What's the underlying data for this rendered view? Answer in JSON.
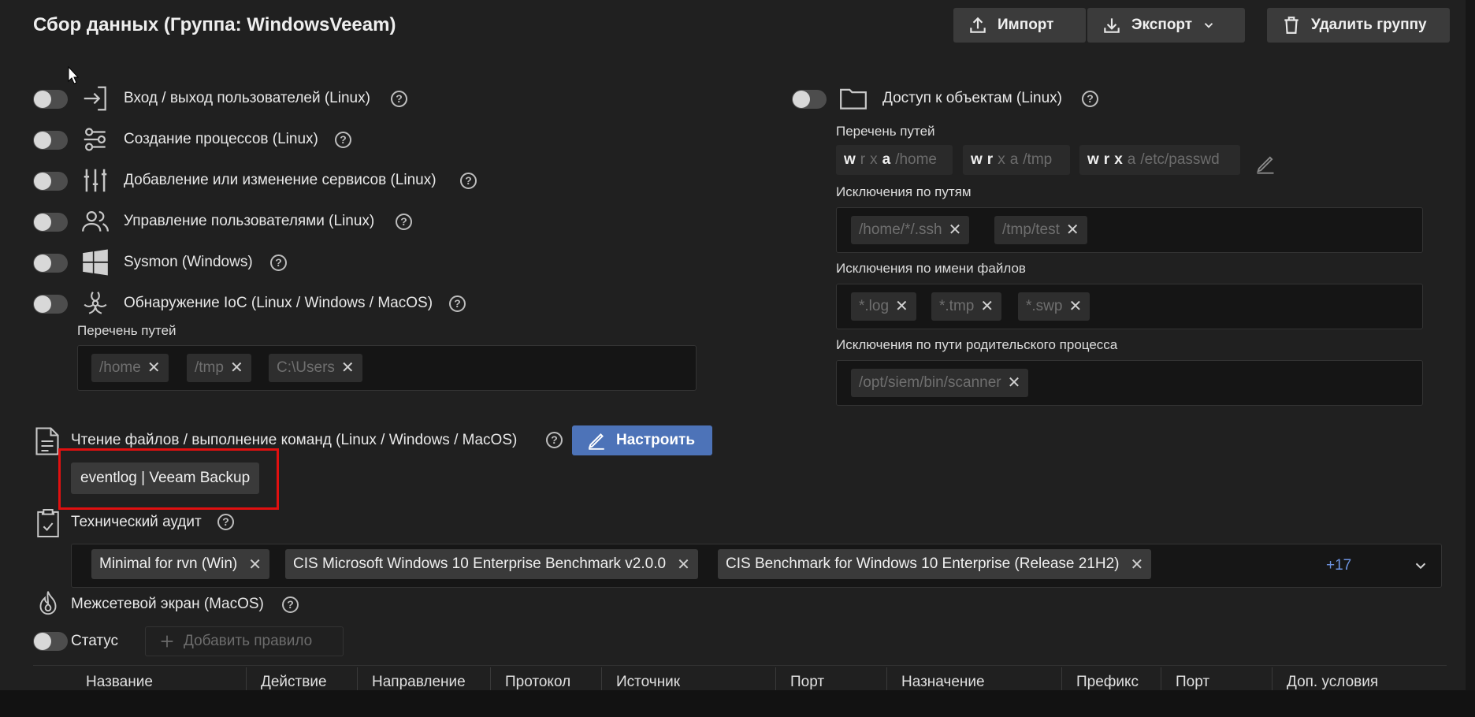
{
  "header": {
    "title": "Сбор данных (Группа: WindowsVeeam)",
    "import_label": "Импорт",
    "export_label": "Экспорт",
    "delete_group_label": "Удалить группу"
  },
  "left_items": [
    {
      "label": "Вход / выход пользователей (Linux)",
      "icon": "login-icon"
    },
    {
      "label": "Создание процессов (Linux)",
      "icon": "process-icon"
    },
    {
      "label": "Добавление или изменение сервисов (Linux)",
      "icon": "sliders-icon"
    },
    {
      "label": "Управление пользователями (Linux)",
      "icon": "users-icon"
    },
    {
      "label": "Sysmon (Windows)",
      "icon": "windows-icon"
    },
    {
      "label": "Обнаружение IoC (Linux / Windows / MacOS)",
      "icon": "biohazard-icon"
    }
  ],
  "ioc": {
    "paths_label": "Перечень путей",
    "paths": [
      "/home",
      "/tmp",
      "C:\\Users"
    ]
  },
  "object_access": {
    "label": "Доступ к объектам (Linux)",
    "paths_label": "Перечень путей",
    "paths": [
      {
        "perm": [
          "w",
          "r",
          "x",
          "a"
        ],
        "active": [
          true,
          false,
          false,
          true
        ],
        "path": "/home"
      },
      {
        "perm": [
          "w",
          "r",
          "x",
          "a"
        ],
        "active": [
          true,
          true,
          false,
          false
        ],
        "path": "/tmp"
      },
      {
        "perm": [
          "w",
          "r",
          "x",
          "a"
        ],
        "active": [
          true,
          true,
          true,
          false
        ],
        "path": "/etc/passwd"
      }
    ],
    "path_exclusions_label": "Исключения по путям",
    "path_exclusions": [
      "/home/*/.ssh",
      "/tmp/test"
    ],
    "file_exclusions_label": "Исключения по имени файлов",
    "file_exclusions": [
      "*.log",
      "*.tmp",
      "*.swp"
    ],
    "parent_exclusions_label": "Исключения по пути родительского процесса",
    "parent_exclusions": [
      "/opt/siem/bin/scanner"
    ]
  },
  "file_reading": {
    "label": "Чтение файлов / выполнение команд (Linux / Windows / MacOS)",
    "configure_label": "Настроить",
    "tag": "eventlog | Veeam Backup"
  },
  "audit": {
    "label": "Технический аудит",
    "chips": [
      "Minimal for rvn (Win)",
      "CIS Microsoft Windows 10 Enterprise Benchmark v2.0.0",
      "CIS Benchmark for Windows 10 Enterprise (Release 21H2)"
    ],
    "more": "+17"
  },
  "firewall": {
    "label": "Межсетевой экран (MacOS)",
    "status_label": "Статус",
    "add_rule_label": "Добавить правило",
    "columns": [
      "Название",
      "Действие",
      "Направление",
      "Протокол",
      "Источник",
      "Порт",
      "Назначение",
      "Префикс",
      "Порт",
      "Доп. условия"
    ]
  },
  "colors": {
    "accent": "#4d73b8",
    "highlight": "#e01010",
    "link": "#6d93e0"
  }
}
